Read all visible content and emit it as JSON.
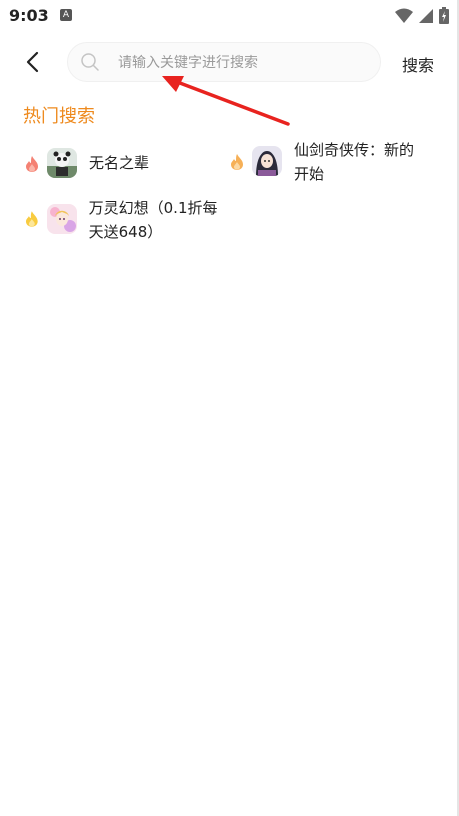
{
  "status_bar": {
    "time": "9:03",
    "notification_icon": "a-icon",
    "icons": [
      "wifi-icon",
      "signal-icon",
      "battery-icon"
    ]
  },
  "search": {
    "placeholder": "请输入关键字进行搜索",
    "value": "",
    "submit_label": "搜索"
  },
  "hot_search": {
    "title": "热门搜索",
    "items": [
      {
        "name": "无名之辈",
        "flame_color": "#f26b5b",
        "avatar": "game-avatar-wumingzhibei"
      },
      {
        "name": "仙剑奇侠传：新的开始",
        "flame_color": "#f5a23a",
        "avatar": "game-avatar-xianjian"
      },
      {
        "name": "万灵幻想（0.1折每天送648）",
        "flame_color": "#f7c52a",
        "avatar": "game-avatar-wanling"
      }
    ]
  },
  "colors": {
    "accent": "#ee8a1e",
    "annotation_arrow": "#e8231f"
  }
}
